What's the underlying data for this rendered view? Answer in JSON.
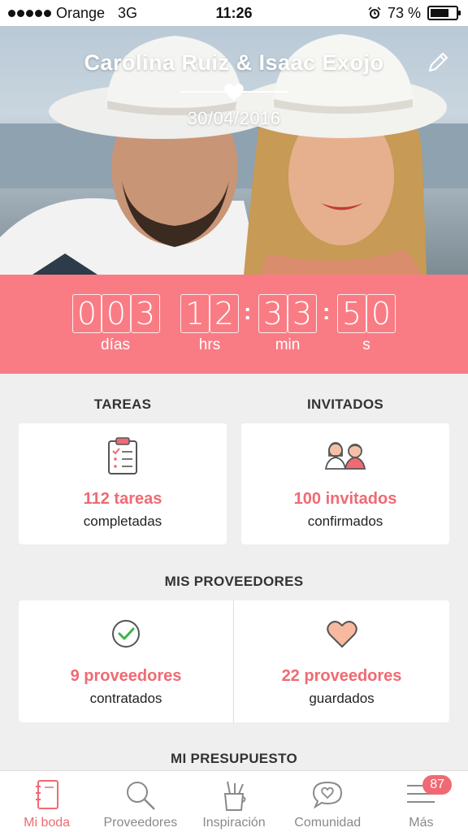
{
  "status_bar": {
    "carrier": "Orange",
    "network": "3G",
    "time": "11:26",
    "battery_text": "73 %",
    "battery_level": 0.73
  },
  "hero": {
    "couple_names": "Carolina Ruiz & Isaac Exojo",
    "wedding_date": "30/04/2016",
    "icons": [
      "edit-icon",
      "heart-icon"
    ]
  },
  "countdown": {
    "days_digits": [
      "0",
      "0",
      "3"
    ],
    "hours_digits": [
      "1",
      "2"
    ],
    "minutes_digits": [
      "3",
      "3"
    ],
    "seconds_digits": [
      "5",
      "0"
    ],
    "labels": {
      "days": "días",
      "hours": "hrs",
      "minutes": "min",
      "seconds": "s"
    },
    "background_color": "#f97c85"
  },
  "tasks": {
    "title": "TAREAS",
    "value": "112 tareas",
    "subtitle": "completadas",
    "icon": "clipboard-icon"
  },
  "guests": {
    "title": "INVITADOS",
    "value": "100 invitados",
    "subtitle": "confirmados",
    "icon": "guests-icon"
  },
  "vendors": {
    "title": "MIS PROVEEDORES",
    "hired": {
      "value": "9 proveedores",
      "subtitle": "contratados",
      "icon": "check-circle-icon"
    },
    "saved": {
      "value": "22 proveedores",
      "subtitle": "guardados",
      "icon": "heart-outline-icon"
    }
  },
  "budget": {
    "title": "MI PRESUPUESTO"
  },
  "tab_bar": {
    "tabs": [
      {
        "label": "Mi boda",
        "icon": "notebook-icon",
        "active": true
      },
      {
        "label": "Proveedores",
        "icon": "search-icon",
        "active": false
      },
      {
        "label": "Inspiración",
        "icon": "pencil-cup-icon",
        "active": false
      },
      {
        "label": "Comunidad",
        "icon": "chat-heart-icon",
        "active": false
      },
      {
        "label": "Más",
        "icon": "menu-icon",
        "active": false
      }
    ],
    "more_badge": "87"
  },
  "colors": {
    "accent": "#ef6a73",
    "countdown": "#f97c85",
    "background": "#efefef"
  }
}
